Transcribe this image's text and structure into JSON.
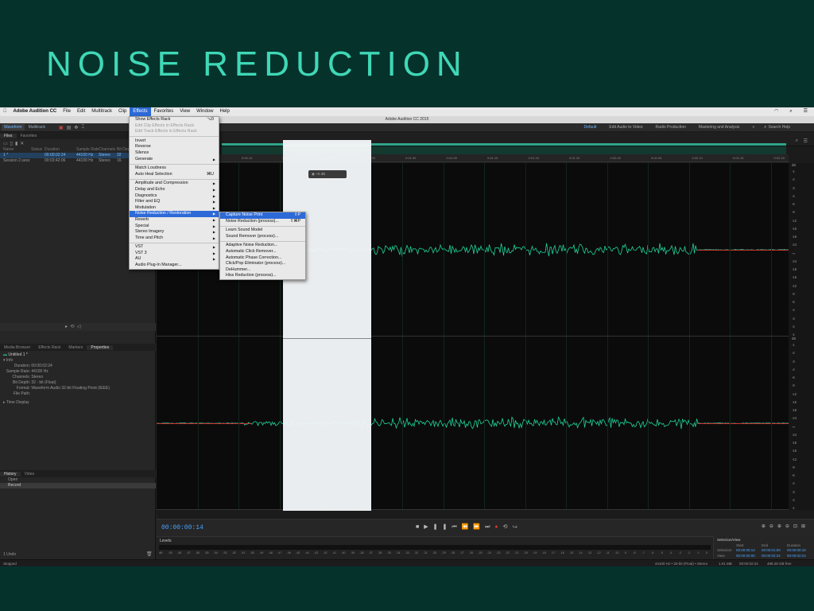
{
  "slide": {
    "title": "NOISE REDUCTION"
  },
  "menubar": {
    "apple": "",
    "app_name": "Adobe Audition CC",
    "items": [
      "File",
      "Edit",
      "Multitrack",
      "Clip",
      "Effects",
      "Favorites",
      "View",
      "Window",
      "Help"
    ],
    "active": "Effects"
  },
  "titlebar": {
    "title": "Adobe Audition CC 2015"
  },
  "toolbar": {
    "waveform": "Waveform",
    "multitrack": "Multitrack",
    "workspaces": [
      "Default",
      "Edit Audio to Video",
      "Radio Production",
      "Mastering and Analysis"
    ],
    "search": "Search Help"
  },
  "files_panel": {
    "tabs": [
      "Files",
      "Favorites"
    ],
    "columns": [
      "Name",
      "Status",
      "Duration",
      "Sample Rate",
      "Channels",
      "Bit Depth"
    ],
    "rows": [
      {
        "name": "1 *",
        "status": "",
        "duration": "00:00:02:24",
        "rate": "44100 Hz",
        "channels": "Stereo",
        "bits": "32"
      },
      {
        "name": "Session 2.sesx",
        "status": "",
        "duration": "00:03:42:06",
        "rate": "44100 Hz",
        "channels": "Stereo",
        "bits": "16"
      }
    ]
  },
  "props_panel": {
    "tabs": [
      "Media Browser",
      "Effects Rack",
      "Markers",
      "Properties"
    ],
    "file": "Untitled 1 *",
    "section": "Info",
    "fields": [
      {
        "k": "Duration:",
        "v": "00:00:02:24"
      },
      {
        "k": "Sample Rate:",
        "v": "44100 Hz"
      },
      {
        "k": "Channels:",
        "v": "Stereo"
      },
      {
        "k": "Bit Depth:",
        "v": "32 - bit (Float)"
      },
      {
        "k": "Format:",
        "v": "Waveform Audio 32-bit Floating Point (IEEE)"
      },
      {
        "k": "File Path:",
        "v": ""
      }
    ],
    "time_display": "Time Display"
  },
  "history_panel": {
    "tabs": [
      "History",
      "Video"
    ],
    "items": [
      "Open",
      "Record"
    ],
    "undo": "1 Undo"
  },
  "status": {
    "left": "Stopped",
    "right": [
      "44100 Hz • 32-bit (Float) • Stereo",
      "1.01 MB",
      "00:00:02:24",
      "488.28 GB free"
    ]
  },
  "ruler": {
    "labels": [
      "hms",
      "0:00.05",
      "0:00.10",
      "0:00.15",
      "0:00.20",
      "0:00.25",
      "0:01.00",
      "0:01.05",
      "0:01.10",
      "0:01.15",
      "0:01.20",
      "0:02.00",
      "0:02.05",
      "0:02.10",
      "0:02.15",
      "0:02.20"
    ]
  },
  "db_scale": {
    "unit": "dB",
    "labels": [
      "-1",
      "-2",
      "-3",
      "-4",
      "-6",
      "-9",
      "-12",
      "-15",
      "-18",
      "-24",
      "-∞",
      "-24",
      "-18",
      "-15",
      "-12",
      "-9",
      "-6",
      "-4",
      "-3",
      "-2",
      "-1"
    ]
  },
  "hud": {
    "value": "+0 dB"
  },
  "transport": {
    "timecode": "00:00:00:14"
  },
  "levels": {
    "title": "Levels",
    "scale": [
      "dB",
      "-59",
      "-58",
      "-57",
      "-56",
      "-55",
      "-54",
      "-53",
      "-52",
      "-51",
      "-50",
      "-49",
      "-48",
      "-47",
      "-46",
      "-45",
      "-44",
      "-43",
      "-42",
      "-41",
      "-40",
      "-39",
      "-38",
      "-37",
      "-36",
      "-35",
      "-34",
      "-33",
      "-32",
      "-31",
      "-30",
      "-29",
      "-28",
      "-27",
      "-26",
      "-25",
      "-24",
      "-23",
      "-22",
      "-21",
      "-20",
      "-19",
      "-18",
      "-17",
      "-16",
      "-15",
      "-14",
      "-13",
      "-12",
      "-11",
      "-10",
      "-9",
      "-8",
      "-7",
      "-6",
      "-5",
      "-4",
      "-3",
      "-2",
      "-1",
      "0"
    ]
  },
  "selection_view": {
    "title": "Selection/View",
    "headers": [
      "Start",
      "End",
      "Duration"
    ],
    "selection": [
      "Selection",
      "00:00:00:14",
      "00:00:01:00",
      "00:00:00:16"
    ],
    "view": [
      "View",
      "00:00:00:00",
      "00:00:02:24",
      "00:00:02:24"
    ]
  },
  "effects_menu": [
    {
      "label": "Show Effects Rack",
      "sc": "⌥0"
    },
    {
      "label": "Edit Clip Effects in Effects Rack",
      "dis": true
    },
    {
      "label": "Edit Track Effects in Effects Rack",
      "dis": true
    },
    {
      "sep": true
    },
    {
      "label": "Invert"
    },
    {
      "label": "Reverse"
    },
    {
      "label": "Silence"
    },
    {
      "label": "Generate",
      "sub": true
    },
    {
      "sep": true
    },
    {
      "label": "Match Loudness"
    },
    {
      "label": "Auto Heal Selection",
      "sc": "⌘U"
    },
    {
      "sep": true
    },
    {
      "label": "Amplitude and Compression",
      "sub": true
    },
    {
      "label": "Delay and Echo",
      "sub": true
    },
    {
      "label": "Diagnostics",
      "sub": true
    },
    {
      "label": "Filter and EQ",
      "sub": true
    },
    {
      "label": "Modulation",
      "sub": true
    },
    {
      "label": "Noise Reduction / Restoration",
      "sub": true,
      "hl": true
    },
    {
      "label": "Reverb",
      "sub": true
    },
    {
      "label": "Special",
      "sub": true
    },
    {
      "label": "Stereo Imagery",
      "sub": true
    },
    {
      "label": "Time and Pitch",
      "sub": true
    },
    {
      "sep": true
    },
    {
      "label": "VST",
      "sub": true
    },
    {
      "label": "VST 3",
      "sub": true
    },
    {
      "label": "AU",
      "sub": true
    },
    {
      "label": "Audio Plug-In Manager..."
    }
  ],
  "noise_submenu": [
    {
      "label": "Capture Noise Print",
      "sc": "⇧P",
      "hl": true
    },
    {
      "label": "Noise Reduction (process)...",
      "sc": "⇧⌘P"
    },
    {
      "sep": true
    },
    {
      "label": "Learn Sound Model"
    },
    {
      "label": "Sound Remover (process)..."
    },
    {
      "sep": true
    },
    {
      "label": "Adaptive Noise Reduction..."
    },
    {
      "label": "Automatic Click Remover..."
    },
    {
      "label": "Automatic Phase Correction..."
    },
    {
      "label": "Click/Pop Eliminator (process)..."
    },
    {
      "label": "DeHummer..."
    },
    {
      "label": "Hiss Reduction (process)..."
    }
  ],
  "colors": {
    "background": "#06322c",
    "title": "#3fd8b6",
    "waveform": "#1fd39a",
    "accent": "#2d6ad8"
  }
}
